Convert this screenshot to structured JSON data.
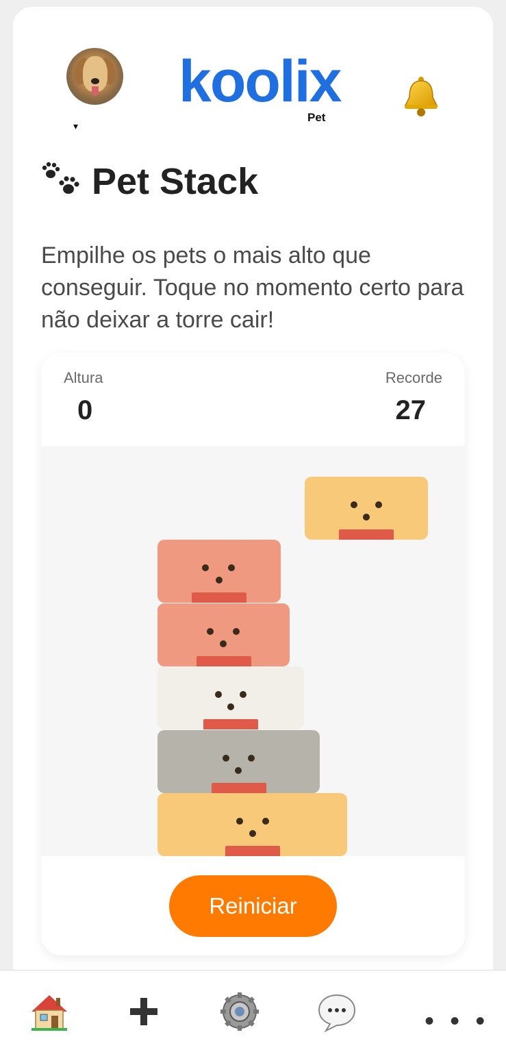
{
  "header": {
    "logo_text": "koolix",
    "logo_sub": "Pet",
    "caret": "▾"
  },
  "page": {
    "title": "Pet Stack",
    "description": "Empilhe os pets o mais alto que conseguir. Toque no momento certo para não deixar a torre cair!"
  },
  "game": {
    "height_label": "Altura",
    "height_value": "0",
    "record_label": "Recorde",
    "record_value": "27",
    "restart_label": "Reiniciar",
    "blocks": [
      {
        "name": "moving-pet-block",
        "color": "#f9c97a"
      },
      {
        "name": "stacked-pet-block-5",
        "color": "#ef9a80"
      },
      {
        "name": "stacked-pet-block-4",
        "color": "#ef9a80"
      },
      {
        "name": "stacked-pet-block-3",
        "color": "#f2efe9"
      },
      {
        "name": "stacked-pet-block-2",
        "color": "#b6b3ab"
      },
      {
        "name": "stacked-pet-block-1",
        "color": "#f9c97a"
      }
    ]
  },
  "bottom_nav": {
    "items": [
      {
        "name": "home-icon"
      },
      {
        "name": "add-icon"
      },
      {
        "name": "settings-icon"
      },
      {
        "name": "chat-icon"
      },
      {
        "name": "more-icon",
        "label": "• • •"
      }
    ]
  },
  "colors": {
    "accent": "#ff7a00",
    "logo": "#1f6fe0",
    "mouth": "#e05a4a"
  }
}
